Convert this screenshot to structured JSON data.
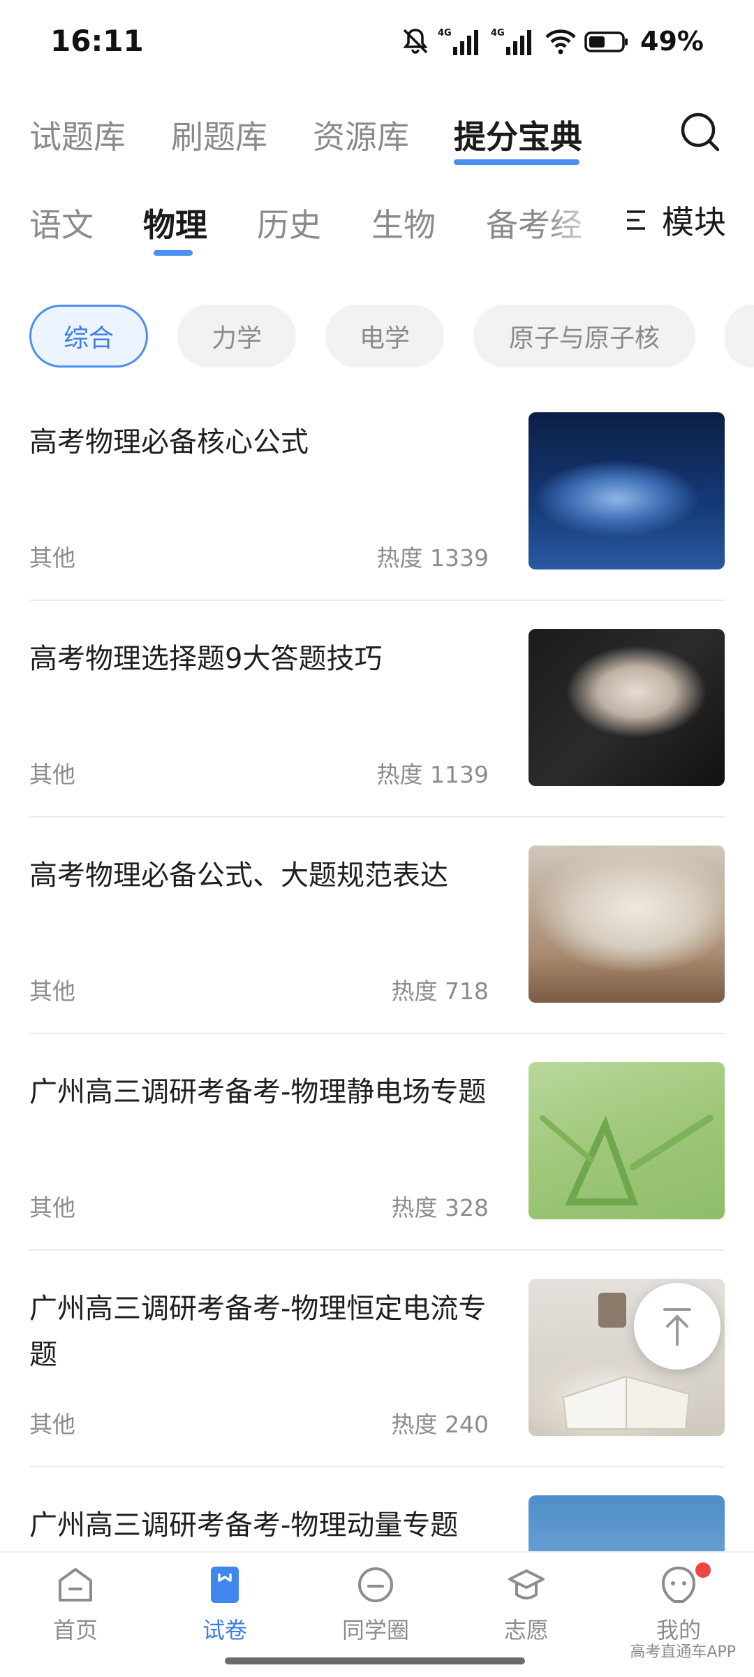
{
  "status_bar": {
    "time": "16:11",
    "network_1": "4G",
    "network_2": "4G",
    "battery": "49%"
  },
  "top_tabs": [
    {
      "label": "试题库"
    },
    {
      "label": "刷题库"
    },
    {
      "label": "资源库"
    },
    {
      "label": "提分宝典",
      "active": true
    }
  ],
  "subject_tabs": [
    {
      "label": "语文"
    },
    {
      "label": "物理",
      "active": true
    },
    {
      "label": "历史"
    },
    {
      "label": "生物"
    },
    {
      "label": "备考经"
    }
  ],
  "module_button": {
    "label": "模块",
    "icon": "menu-list-icon"
  },
  "filter_chips": [
    {
      "label": "综合",
      "active": true
    },
    {
      "label": "力学"
    },
    {
      "label": "电学"
    },
    {
      "label": "原子与原子核"
    }
  ],
  "articles": [
    {
      "title": "高考物理必备核心公式",
      "category": "其他",
      "heat": "热度 1339"
    },
    {
      "title": "高考物理选择题9大答题技巧",
      "category": "其他",
      "heat": "热度 1139"
    },
    {
      "title": "高考物理必备公式、大题规范表达",
      "category": "其他",
      "heat": "热度 718"
    },
    {
      "title": "广州高三调研考备考-物理静电场专题",
      "category": "其他",
      "heat": "热度 328"
    },
    {
      "title": "广州高三调研考备考-物理恒定电流专题",
      "category": "其他",
      "heat": "热度 240"
    },
    {
      "title": "广州高三调研考备考-物理动量专题",
      "category": "",
      "heat": ""
    }
  ],
  "bottom_nav": [
    {
      "label": "首页",
      "icon": "home-icon"
    },
    {
      "label": "试卷",
      "icon": "paper-icon",
      "active": true
    },
    {
      "label": "同学圈",
      "icon": "chat-bubble-icon"
    },
    {
      "label": "志愿",
      "icon": "graduation-cap-icon"
    },
    {
      "label": "我的",
      "icon": "profile-face-icon",
      "badge": true
    }
  ],
  "watermark": "高考直通车APP",
  "colors": {
    "accent": "#4a8ef0",
    "badge": "#ef4444"
  }
}
